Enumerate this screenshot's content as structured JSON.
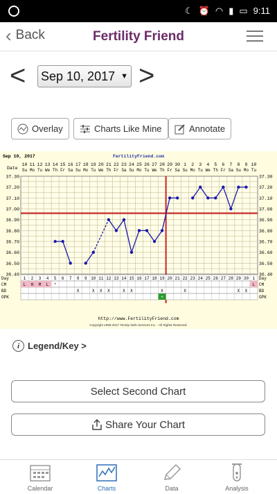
{
  "status_bar": {
    "time": "9:11"
  },
  "header": {
    "back_label": "Back",
    "title": "Fertility Friend"
  },
  "date_selector": {
    "value": "Sep 10, 2017",
    "prev": "<",
    "next": ">"
  },
  "toolbar": {
    "overlay": "Overlay",
    "charts_like_mine": "Charts Like Mine",
    "annotate": "Annotate"
  },
  "chart": {
    "date_label": "Sep 10, 2017",
    "site_label": "FertilityFriend.com",
    "footer_url": "http://www.FertilityFriend.com",
    "copyright": "Copyright 1998-2017 Tentrip Web Services Inc. - All Rights Reserved.",
    "row_labels": {
      "date": "Date",
      "day": "Day",
      "cm": "CM",
      "bd": "BD",
      "opk": "OPK"
    }
  },
  "chart_data": {
    "type": "line",
    "dates": [
      "10",
      "11",
      "12",
      "13",
      "14",
      "15",
      "16",
      "17",
      "18",
      "19",
      "20",
      "21",
      "22",
      "23",
      "24",
      "25",
      "26",
      "27",
      "28",
      "29",
      "30",
      "1",
      "2",
      "3",
      "4",
      "5",
      "6",
      "7",
      "8",
      "9",
      "10"
    ],
    "weekdays": [
      "Su",
      "Mo",
      "Tu",
      "We",
      "Th",
      "Fr",
      "Sa",
      "Su",
      "Mo",
      "Tu",
      "We",
      "Th",
      "Fr",
      "Sa",
      "Su",
      "Mo",
      "Tu",
      "We",
      "Th",
      "Fr",
      "Sa",
      "Su",
      "Mo",
      "Tu",
      "We",
      "Th",
      "Fr",
      "Sa",
      "Su",
      "Mo",
      "Tu"
    ],
    "cycle_days": [
      "1",
      "2",
      "3",
      "4",
      "5",
      "6",
      "7",
      "8",
      "9",
      "10",
      "11",
      "12",
      "13",
      "14",
      "15",
      "16",
      "17",
      "18",
      "19",
      "20",
      "21",
      "22",
      "23",
      "24",
      "25",
      "26",
      "27",
      "28",
      "29",
      "30",
      "1"
    ],
    "temps": [
      null,
      null,
      null,
      null,
      36.7,
      36.7,
      36.5,
      null,
      36.5,
      36.6,
      null,
      36.9,
      36.8,
      36.9,
      36.6,
      36.8,
      36.8,
      36.7,
      36.8,
      37.1,
      37.1,
      null,
      37.1,
      37.2,
      37.1,
      37.1,
      37.2,
      37.0,
      37.2,
      37.2,
      null
    ],
    "dashed_segments": [
      [
        9,
        11
      ]
    ],
    "y_ticks": [
      "37.30",
      "37.20",
      "37.10",
      "37.00",
      "36.90",
      "36.80",
      "36.70",
      "36.60",
      "36.50",
      "36.40"
    ],
    "ylim": [
      36.4,
      37.3
    ],
    "coverline": 36.96,
    "ovulation_day_index": 18,
    "cm": [
      "L",
      "H",
      "M",
      "L",
      "*",
      "",
      "",
      "",
      "",
      "",
      "",
      "",
      "",
      "",
      "",
      "",
      "",
      "",
      "",
      "",
      "",
      "",
      "",
      "",
      "",
      "",
      "",
      "",
      "",
      "",
      "L"
    ],
    "bd": [
      "",
      "",
      "",
      "",
      "",
      "",
      "",
      "X",
      "",
      "X",
      "X",
      "X",
      "",
      "X",
      "X",
      "",
      "",
      "",
      "X",
      "",
      "",
      "X",
      "",
      "",
      "",
      "",
      "",
      "",
      "X",
      "X",
      ""
    ],
    "opk": [
      "",
      "",
      "",
      "",
      "",
      "",
      "",
      "",
      "",
      "",
      "",
      "",
      "",
      "",
      "",
      "",
      "",
      "",
      "+",
      "",
      "",
      "",
      "",
      "",
      "",
      "",
      "",
      "",
      "",
      "",
      ""
    ],
    "colors": {
      "line": "#1a1aa8",
      "coverline": "#cc2222",
      "cm_menstruation": "#f3b8c6",
      "opk_positive": "#2e9b2e",
      "grid": "#b9b28a"
    }
  },
  "legend": {
    "label": "Legend/Key >"
  },
  "actions": {
    "select_second": "Select Second Chart",
    "share": "Share Your Chart"
  },
  "tabs": [
    {
      "label": "Calendar",
      "icon": "calendar-icon"
    },
    {
      "label": "Charts",
      "icon": "chart-icon"
    },
    {
      "label": "Data",
      "icon": "pencil-icon"
    },
    {
      "label": "Analysis",
      "icon": "test-tube-icon"
    }
  ]
}
